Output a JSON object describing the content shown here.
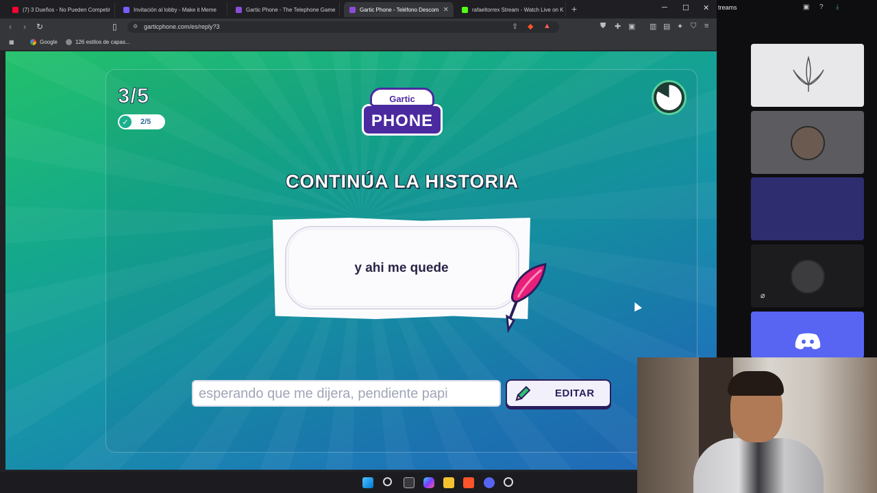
{
  "browser": {
    "tabs": [
      {
        "label": "(7) 3 Dueños - No Pueden Competir",
        "color": "#ff0033",
        "active": false
      },
      {
        "label": "Invitación al lobby - Make it Meme",
        "color": "#7a5cff",
        "active": false
      },
      {
        "label": "Gartic Phone - The Telephone Game",
        "color": "#8b4dd8",
        "active": false
      },
      {
        "label": "Gartic Phone - Teléfono Descom",
        "color": "#8b4dd8",
        "active": true
      },
      {
        "label": "rafaeltorrex Stream - Watch Live on K",
        "color": "#53fc18",
        "active": false
      }
    ],
    "url": "garticphone.com/es/reply?3",
    "bookmarks": [
      {
        "label": "Google"
      },
      {
        "label": "126 estilos de capas..."
      }
    ]
  },
  "game": {
    "round": "3/5",
    "done_count": "2/5",
    "logo_top": "Gartic",
    "logo_bottom": "PHONE",
    "heading": "CONTINÚA LA HISTORIA",
    "story_text": "y ahi me quede",
    "answer_value": "esperando que me dijera, pendiente papi",
    "edit_label": "EDITAR",
    "timer_fraction": 0.83
  },
  "side": {
    "title": "treams"
  },
  "colors": {
    "accent": "#2a1d5c",
    "gartic_purple": "#4b2aa0",
    "feather_pink": "#e8207a",
    "discord": "#5865f2"
  }
}
